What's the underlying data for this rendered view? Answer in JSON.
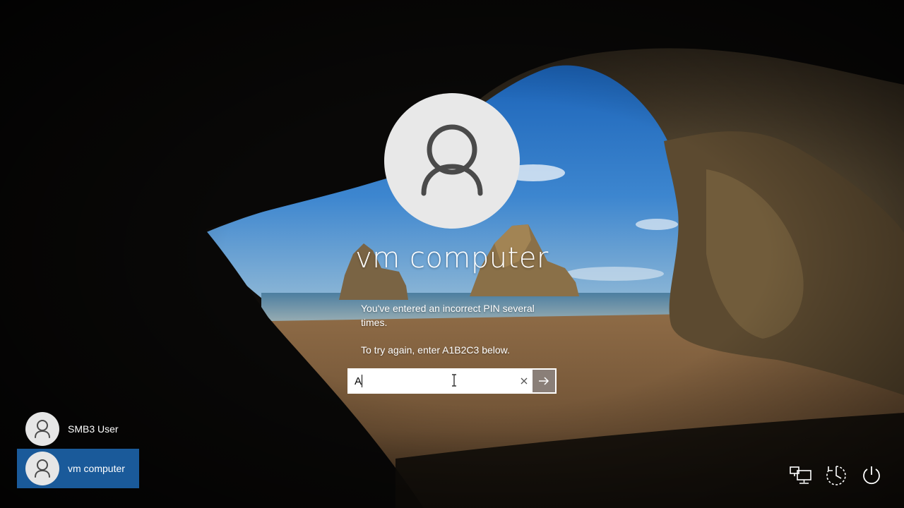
{
  "lockscreen": {
    "username": "vm computer",
    "message_line1": "You've entered an incorrect PIN several times.",
    "message_line2": "To try again, enter A1B2C3 below.",
    "pin_input_value": "A"
  },
  "user_list": [
    {
      "label": "SMB3 User",
      "selected": false
    },
    {
      "label": "vm computer",
      "selected": true
    }
  ],
  "tray_icons": [
    "network-icon",
    "ease-of-access-icon",
    "power-icon"
  ],
  "colors": {
    "selected_user_bg": "#1a5a9a",
    "submit_button_bg": "#8a7f78",
    "avatar_bg": "#e8e8e8",
    "avatar_figure": "#4a4a4a"
  }
}
